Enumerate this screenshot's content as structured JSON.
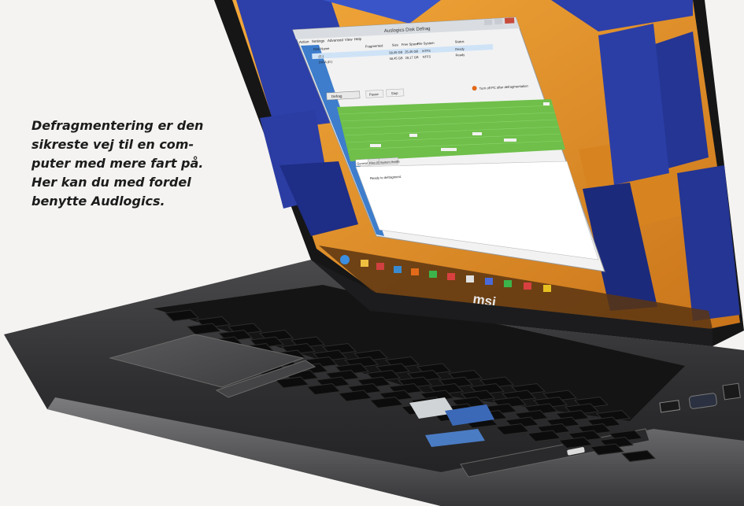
{
  "caption": {
    "lines": [
      "Defragmentering er den",
      "sikreste vej til en com-",
      "puter med mere fart på.",
      "Her kan du med fordel",
      "benytte Audlogics."
    ]
  },
  "app_window": {
    "title": "Auslogics Disk Defrag",
    "menu": [
      "Action",
      "Settings",
      "Advanced",
      "View",
      "Help"
    ],
    "columns": [
      "Disk Name",
      "Fragmented",
      "Size",
      "Free Space",
      "File System",
      "Status"
    ],
    "rows": [
      {
        "name": "(C:)",
        "fragmented": "",
        "size": "58,45 GB",
        "free": "25,45 GB",
        "fs": "NTFS",
        "status": "Ready"
      },
      {
        "name": "DATA (D:)",
        "fragmented": "",
        "size": "58,45 GB",
        "free": "28,17 GB",
        "fs": "NTFS",
        "status": "Ready"
      }
    ],
    "defrag_button": "Defrag",
    "pause_button": "Pause",
    "stop_button": "Stop",
    "turn_off_label": "Turn off PC after defragmentation",
    "tabs": [
      "General",
      "Files (0)",
      "System Health"
    ],
    "status_text": "Ready to defragment."
  },
  "laptop": {
    "brand": "msi"
  },
  "colors": {
    "cluster_green": "#6fbf4a",
    "wallpaper_orange": "#e7951f",
    "wallpaper_blue": "#2d3fa8",
    "body_dark": "#2a2a2c"
  }
}
